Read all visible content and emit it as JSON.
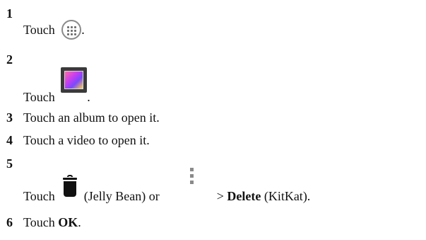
{
  "steps": [
    {
      "number": "1",
      "text_before": "Touch",
      "text_after": ".",
      "icon": "apps-icon"
    },
    {
      "number": "2",
      "text_before": "Touch",
      "text_after": ".",
      "icon": "gallery-icon"
    },
    {
      "number": "3",
      "text": "Touch an album to open it."
    },
    {
      "number": "4",
      "text": "Touch a video to open it."
    },
    {
      "number": "5",
      "text_before": "Touch",
      "text_mid": "(Jelly Bean) or",
      "text_sep": ">",
      "bold": "Delete",
      "text_after": "(KitKat).",
      "icons": [
        "trash-icon",
        "overflow-menu-icon"
      ]
    },
    {
      "number": "6",
      "text_before": "Touch",
      "bold": "OK",
      "text_after": "."
    }
  ]
}
